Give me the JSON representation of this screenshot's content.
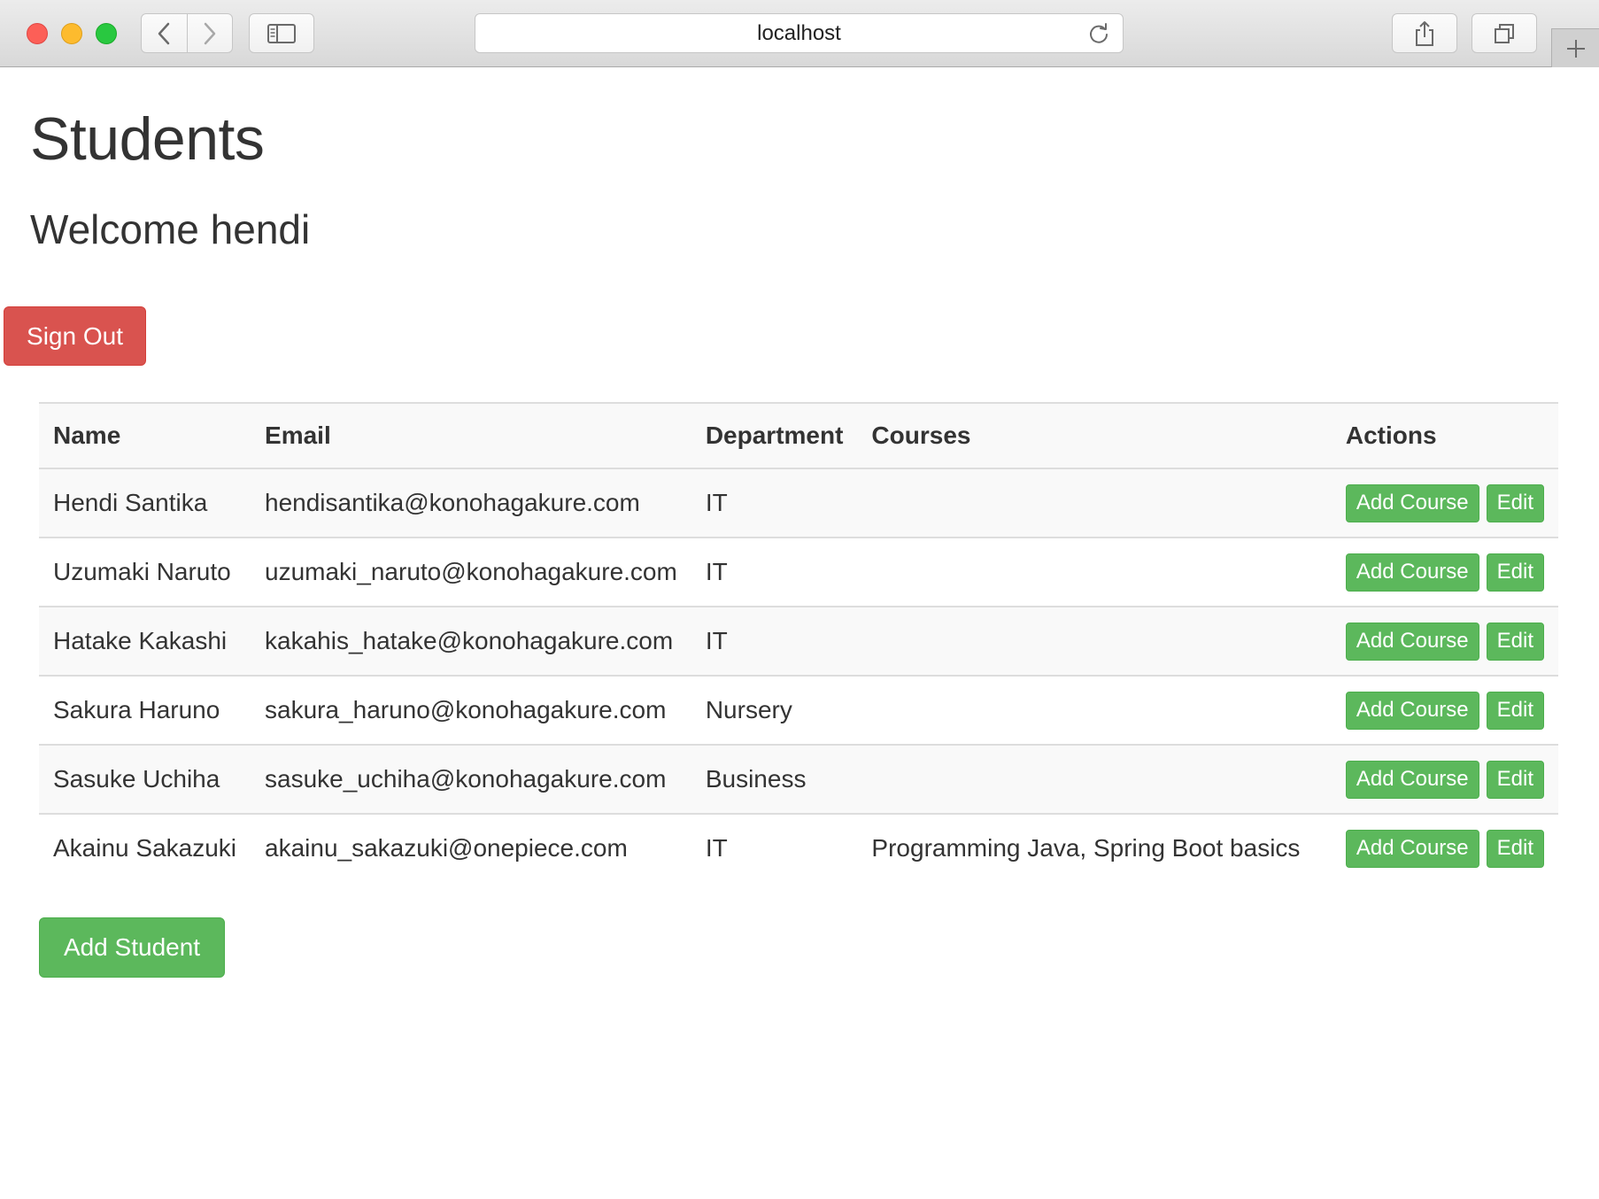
{
  "browser": {
    "address": "localhost"
  },
  "page": {
    "title": "Students",
    "welcome": "Welcome hendi",
    "sign_out_label": "Sign Out",
    "add_student_label": "Add Student"
  },
  "table": {
    "headers": {
      "name": "Name",
      "email": "Email",
      "department": "Department",
      "courses": "Courses",
      "actions": "Actions"
    },
    "action_labels": {
      "add_course": "Add Course",
      "edit": "Edit"
    },
    "rows": [
      {
        "name": "Hendi Santika",
        "email": "hendisantika@konohagakure.com",
        "department": "IT",
        "courses": ""
      },
      {
        "name": "Uzumaki Naruto",
        "email": "uzumaki_naruto@konohagakure.com",
        "department": "IT",
        "courses": ""
      },
      {
        "name": "Hatake Kakashi",
        "email": "kakahis_hatake@konohagakure.com",
        "department": "IT",
        "courses": ""
      },
      {
        "name": "Sakura Haruno",
        "email": "sakura_haruno@konohagakure.com",
        "department": "Nursery",
        "courses": ""
      },
      {
        "name": "Sasuke Uchiha",
        "email": "sasuke_uchiha@konohagakure.com",
        "department": "Business",
        "courses": ""
      },
      {
        "name": "Akainu Sakazuki",
        "email": "akainu_sakazuki@onepiece.com",
        "department": "IT",
        "courses": "Programming Java, Spring Boot basics"
      }
    ]
  },
  "colors": {
    "danger": "#d9534f",
    "success": "#5cb85c"
  },
  "icons": {
    "back": "chevron-left-icon",
    "forward": "chevron-right-icon",
    "sidebar": "sidebar-icon",
    "reload": "reload-icon",
    "share": "share-icon",
    "tabs": "tabs-icon",
    "new_tab": "plus-icon"
  }
}
